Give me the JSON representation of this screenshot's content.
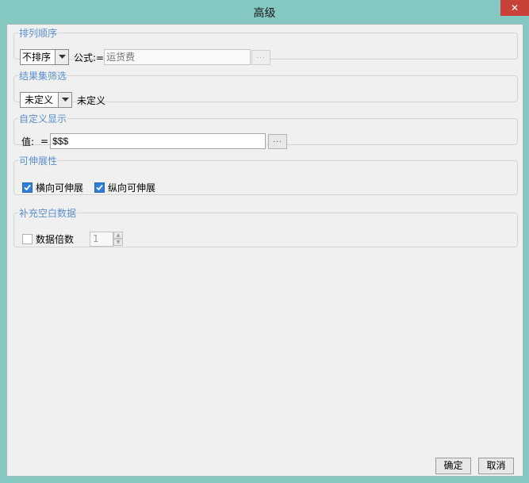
{
  "window": {
    "title": "高级",
    "close_label": "✕"
  },
  "sort": {
    "legend": "排列顺序",
    "combo_value": "不排序",
    "formula_label": "公式:=",
    "formula_placeholder": "运货费",
    "browse_label": "..."
  },
  "filter": {
    "legend": "结果集筛选",
    "combo_value": "未定义",
    "status_text": "未定义"
  },
  "custom_display": {
    "legend": "自定义显示",
    "value_label": "值:",
    "equals": "=",
    "value": "$$$",
    "browse_label": "..."
  },
  "stretch": {
    "legend": "可伸展性",
    "horizontal": {
      "label": "横向可伸展",
      "checked": true
    },
    "vertical": {
      "label": "纵向可伸展",
      "checked": true
    }
  },
  "fill_blank": {
    "legend": "补充空白数据",
    "multiple": {
      "label": "数据倍数",
      "checked": false
    },
    "multiple_value": "1"
  },
  "footer": {
    "ok_label": "确定",
    "cancel_label": "取消"
  },
  "icons": {
    "dropdown": "chevron-down-icon",
    "check": "checkmark-icon",
    "spin_up": "triangle-up-icon",
    "spin_down": "triangle-down-icon"
  },
  "colors": {
    "accent": "#2f7fd8",
    "legend_text": "#5a8fcf",
    "titlebar": "#85c7c1",
    "close": "#c9423a"
  }
}
